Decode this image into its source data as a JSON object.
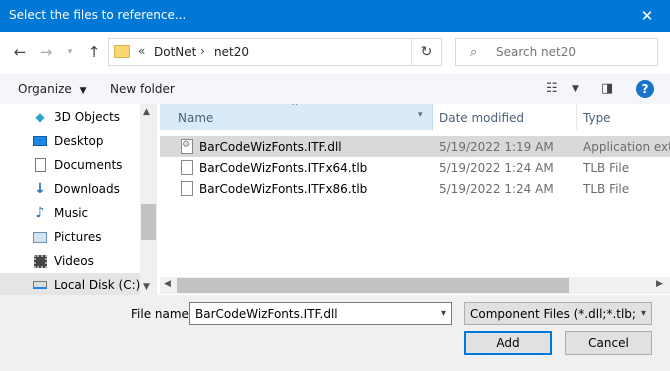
{
  "window": {
    "title": "Select the files to reference..."
  },
  "nav": {
    "breadcrumb": [
      "DotNet",
      "net20"
    ],
    "overflow": "«",
    "search_placeholder": "Search net20"
  },
  "toolbar": {
    "organize": "Organize",
    "new_folder": "New folder"
  },
  "sidebar": {
    "items": [
      {
        "label": "3D Objects",
        "icon": "cube-icon"
      },
      {
        "label": "Desktop",
        "icon": "desktop-icon"
      },
      {
        "label": "Documents",
        "icon": "documents-icon"
      },
      {
        "label": "Downloads",
        "icon": "download-icon"
      },
      {
        "label": "Music",
        "icon": "music-icon"
      },
      {
        "label": "Pictures",
        "icon": "pictures-icon"
      },
      {
        "label": "Videos",
        "icon": "videos-icon"
      },
      {
        "label": "Local Disk (C:)",
        "icon": "drive-icon",
        "selected": true
      }
    ]
  },
  "columns": {
    "name": "Name",
    "date": "Date modified",
    "type": "Type"
  },
  "files": [
    {
      "name": "BarCodeWizFonts.ITF.dll",
      "date": "5/19/2022 1:19 AM",
      "type": "Application exte",
      "selected": true,
      "icon": "dll-file-icon"
    },
    {
      "name": "BarCodeWizFonts.ITFx64.tlb",
      "date": "5/19/2022 1:24 AM",
      "type": "TLB File",
      "selected": false,
      "icon": "file-icon"
    },
    {
      "name": "BarCodeWizFonts.ITFx86.tlb",
      "date": "5/19/2022 1:24 AM",
      "type": "TLB File",
      "selected": false,
      "icon": "file-icon"
    }
  ],
  "footer": {
    "file_name_label": "File name:",
    "file_name_value": "BarCodeWizFonts.ITF.dll",
    "filter_value": "Component Files (*.dll;*.tlb;*.ol",
    "add_label": "Add",
    "cancel_label": "Cancel"
  },
  "colors": {
    "titlebar": "#0078d7",
    "selection": "#d9d9d9",
    "header_active": "#d9ebf9"
  }
}
